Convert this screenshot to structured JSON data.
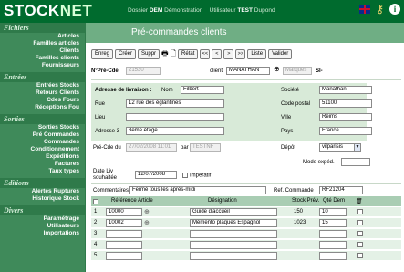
{
  "app": {
    "logo_main": "STOCK",
    "logo_accent": "NET",
    "dossier_label": "Dossier",
    "dossier_value": "DEM",
    "dossier_name": "Démonstration",
    "user_label": "Utilisateur",
    "user_value": "TEST",
    "user_name": "Dupond"
  },
  "sidebar": {
    "sections": [
      {
        "title": "Fichiers",
        "items": [
          "Articles",
          "Familles articles",
          "Clients",
          "Familles clients",
          "Fournisseurs"
        ]
      },
      {
        "title": "Entrées",
        "items": [
          "Entrées Stocks",
          "Retours Clients",
          "Cdes Fours",
          "Réceptions Fou"
        ]
      },
      {
        "title": "Sorties",
        "items": [
          "Sorties Stocks",
          "Pré Commandes",
          "Commandes",
          "Conditionnement",
          "Expéditions",
          "Factures",
          "Taux types"
        ]
      },
      {
        "title": "Editions",
        "items": [
          "Alertes Ruptures",
          "Historique Stock"
        ]
      },
      {
        "title": "Divers",
        "items": [
          "Paramétrage",
          "Utilisateurs",
          "Importations"
        ]
      }
    ]
  },
  "page": {
    "title": "Pré-commandes clients"
  },
  "toolbar": {
    "buttons": [
      "Enreg",
      "Créer",
      "Suppr",
      "Rétat",
      "Liste",
      "Valider"
    ],
    "nav": [
      "<<",
      "<",
      ">",
      ">>"
    ]
  },
  "header": {
    "precde_label": "N°Pré-Cde",
    "precde_value": "21530",
    "client_label": "client",
    "client_value": "MANATHAN",
    "client_extra": "Marques",
    "client_suffix": "Sl-"
  },
  "address": {
    "delivery_label": "Adresse de livraison :",
    "nom_label": "Nom",
    "nom_value": "Filbert",
    "rue_label": "Rue",
    "rue_value": "12 rue des églantines",
    "lieu_label": "Lieu",
    "lieu_value": "",
    "adresse3_label": "Adresse 3",
    "adresse3_value": "3eme étage",
    "societe_label": "Société",
    "societe_value": "Manathan",
    "cp_label": "Code postal",
    "cp_value": "51100",
    "ville_label": "Ville",
    "ville_value": "Reims",
    "pays_label": "Pays",
    "pays_value": "France"
  },
  "order": {
    "precde_du_label": "Pré-Cde du",
    "precde_du_value": "27/02/2008 11:01",
    "par_label": "par",
    "par_value": "TESTNF",
    "depot_label": "Dépôt",
    "depot_value": "vilparisis",
    "mode_label": "Mode expéd.",
    "mode_value": "",
    "date_liv_label_1": "Date Liv",
    "date_liv_label_2": "souhaitée",
    "date_liv_value": "12/07/2008",
    "imperatif_label": "Impératif",
    "comment_label": "Commentaires",
    "comment_value": "Fermé tous les après-midi",
    "ref_label": "Ref. Commande",
    "ref_value": "RF21204"
  },
  "table": {
    "headers": [
      "Référence Article",
      "Désignation",
      "Stock Prév.",
      "Qté Dem"
    ],
    "rows": [
      {
        "num": "1",
        "ref": "10000",
        "designation": "Guide d'accueil",
        "stock": "150",
        "qte": "10"
      },
      {
        "num": "2",
        "ref": "10002",
        "designation": "Mémento plaques Espagnol",
        "stock": "1023",
        "qte": "15"
      },
      {
        "num": "3",
        "ref": "",
        "designation": "",
        "stock": "",
        "qte": ""
      },
      {
        "num": "4",
        "ref": "",
        "designation": "",
        "stock": "",
        "qte": ""
      },
      {
        "num": "5",
        "ref": "",
        "designation": "",
        "stock": "",
        "qte": ""
      }
    ]
  },
  "colors": {
    "topbar": "#006b2e",
    "sidebar": "#3f8a5a",
    "title_bar": "#6fae84",
    "address_bg": "#d8ead8",
    "table_header": "#a9cdb3",
    "table_row": "#e4f1e6"
  },
  "icons": [
    "flag-uk-icon",
    "key-icon",
    "info-icon",
    "print-icon",
    "binoculars-icon"
  ]
}
